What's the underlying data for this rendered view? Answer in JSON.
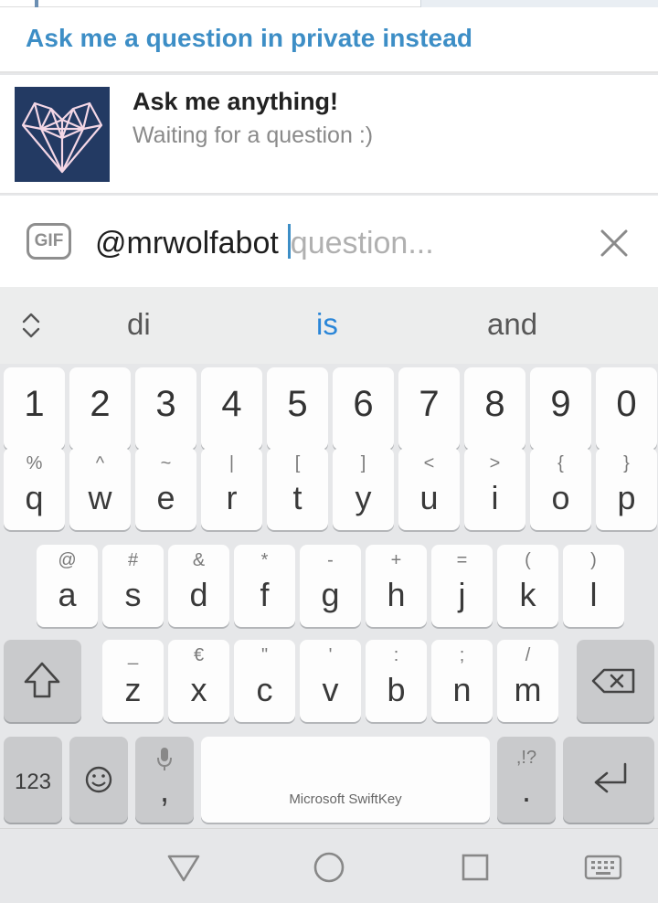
{
  "private_link": {
    "label": "Ask me a question in private instead"
  },
  "result": {
    "title": "Ask me anything!",
    "description": "Waiting for a question :)",
    "thumbnail_icon": "geometric-heart-logo"
  },
  "input": {
    "gif_label": "GIF",
    "value": "@mrwolfabot",
    "placeholder": "question..."
  },
  "keyboard": {
    "suggestions": [
      "di",
      "is",
      "and"
    ],
    "highlighted_suggestion": "is",
    "number_row": [
      "1",
      "2",
      "3",
      "4",
      "5",
      "6",
      "7",
      "8",
      "9",
      "0"
    ],
    "row1": [
      {
        "sec": "%",
        "pri": "q"
      },
      {
        "sec": "^",
        "pri": "w"
      },
      {
        "sec": "~",
        "pri": "e"
      },
      {
        "sec": "|",
        "pri": "r"
      },
      {
        "sec": "[",
        "pri": "t"
      },
      {
        "sec": "]",
        "pri": "y"
      },
      {
        "sec": "<",
        "pri": "u"
      },
      {
        "sec": ">",
        "pri": "i"
      },
      {
        "sec": "{",
        "pri": "o"
      },
      {
        "sec": "}",
        "pri": "p"
      }
    ],
    "row2": [
      {
        "sec": "@",
        "pri": "a"
      },
      {
        "sec": "#",
        "pri": "s"
      },
      {
        "sec": "&",
        "pri": "d"
      },
      {
        "sec": "*",
        "pri": "f"
      },
      {
        "sec": "-",
        "pri": "g"
      },
      {
        "sec": "+",
        "pri": "h"
      },
      {
        "sec": "=",
        "pri": "j"
      },
      {
        "sec": "(",
        "pri": "k"
      },
      {
        "sec": ")",
        "pri": "l"
      }
    ],
    "row3": [
      {
        "sec": "_",
        "pri": "z"
      },
      {
        "sec": "€",
        "pri": "x"
      },
      {
        "sec": "\"",
        "pri": "c"
      },
      {
        "sec": "'",
        "pri": "v"
      },
      {
        "sec": ":",
        "pri": "b"
      },
      {
        "sec": ";",
        "pri": "n"
      },
      {
        "sec": "/",
        "pri": "m"
      }
    ],
    "mode_label": "123",
    "comma_label": ",",
    "period_secondary": ",!?",
    "period_label": ".",
    "space_brand": "Microsoft SwiftKey",
    "accent_color": "#2a86d8"
  },
  "navbar": {
    "icons": [
      "back-icon",
      "home-icon",
      "recents-icon",
      "keyboard-icon"
    ]
  }
}
